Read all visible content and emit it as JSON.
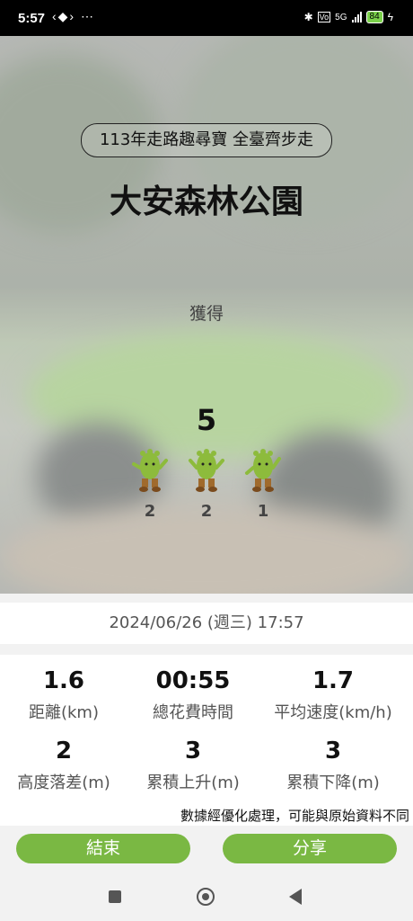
{
  "status": {
    "time": "5:57",
    "left_icons": "‹◆› ⋯",
    "network": "5G",
    "battery": "84"
  },
  "hero": {
    "event_title": "113年走路趣尋寶 全臺齊步走",
    "park_name": "大安森林公園",
    "obtained_label": "獲得",
    "total": "5",
    "mascots": [
      {
        "icon": "mascot-green-icon",
        "count": "2"
      },
      {
        "icon": "mascot-green-icon",
        "count": "2"
      },
      {
        "icon": "mascot-green-icon",
        "count": "1"
      }
    ]
  },
  "date_time": "2024/06/26 (週三) 17:57",
  "stats": [
    {
      "value": "1.6",
      "label": "距離(km)"
    },
    {
      "value": "00:55",
      "label": "總花費時間"
    },
    {
      "value": "1.7",
      "label": "平均速度(km/h)"
    },
    {
      "value": "2",
      "label": "高度落差(m)"
    },
    {
      "value": "3",
      "label": "累積上升(m)"
    },
    {
      "value": "3",
      "label": "累積下降(m)"
    }
  ],
  "disclaimer": "數據經優化處理，可能與原始資料不同",
  "buttons": {
    "end": "結束",
    "share": "分享"
  },
  "colors": {
    "accent": "#7ab843",
    "status_bar": "#000000"
  }
}
